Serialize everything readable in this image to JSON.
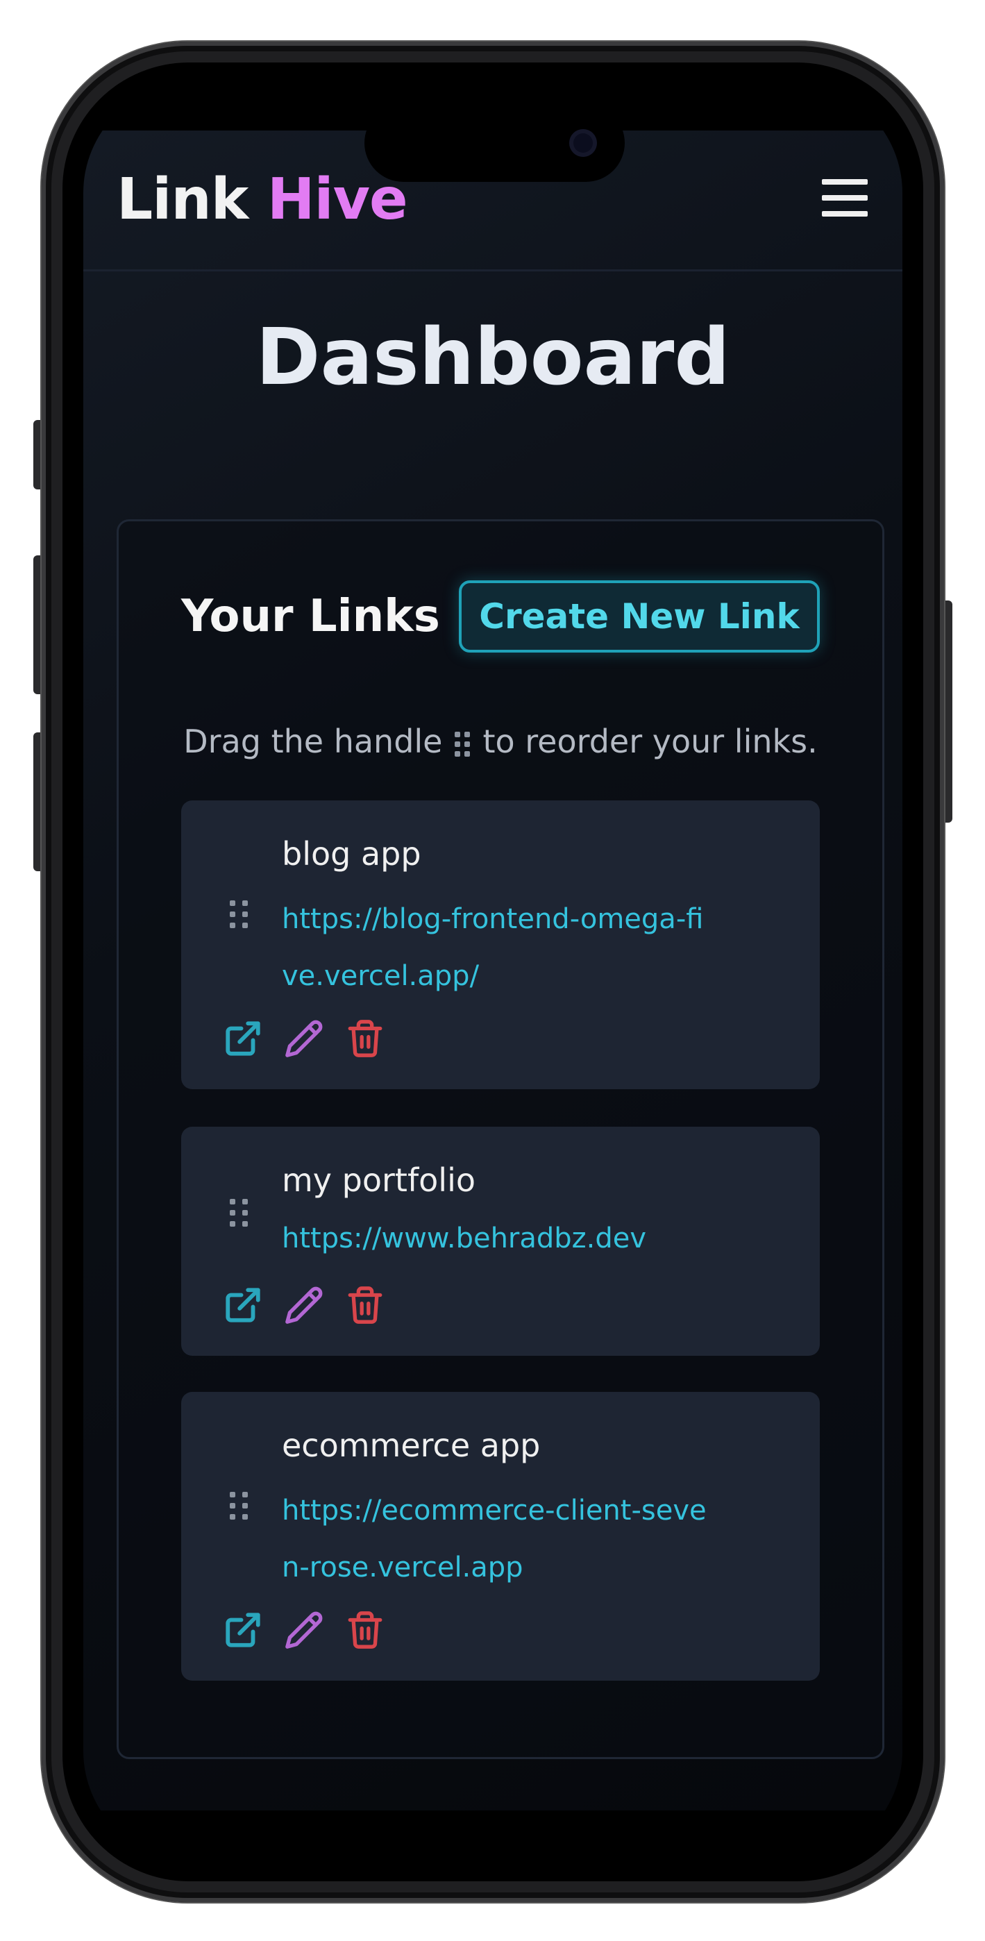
{
  "app": {
    "logo_first": "Link",
    "logo_second": "Hive"
  },
  "page": {
    "title": "Dashboard"
  },
  "links_section": {
    "title": "Your Links",
    "create_label": "Create New Link",
    "hint_before": "Drag the handle",
    "hint_after": "to reorder your links."
  },
  "links": [
    {
      "title": "blog app",
      "url": "https://blog-frontend-omega-five.vercel.app/"
    },
    {
      "title": "my portfolio",
      "url": "https://www.behradbz.dev"
    },
    {
      "title": "ecommerce app",
      "url": "https://ecommerce-client-seven-rose.vercel.app"
    }
  ],
  "icons": {
    "open": "external-link-icon",
    "edit": "pencil-icon",
    "delete": "trash-icon",
    "handle": "drag-handle-icon",
    "menu": "hamburger-menu-icon"
  },
  "colors": {
    "background": "#0b0f16",
    "accent_pink": "#e27cf3",
    "accent_cyan": "#35c3de",
    "edit_purple": "#b367d4",
    "delete_red": "#d9454b",
    "card_item": "#1e2533"
  }
}
